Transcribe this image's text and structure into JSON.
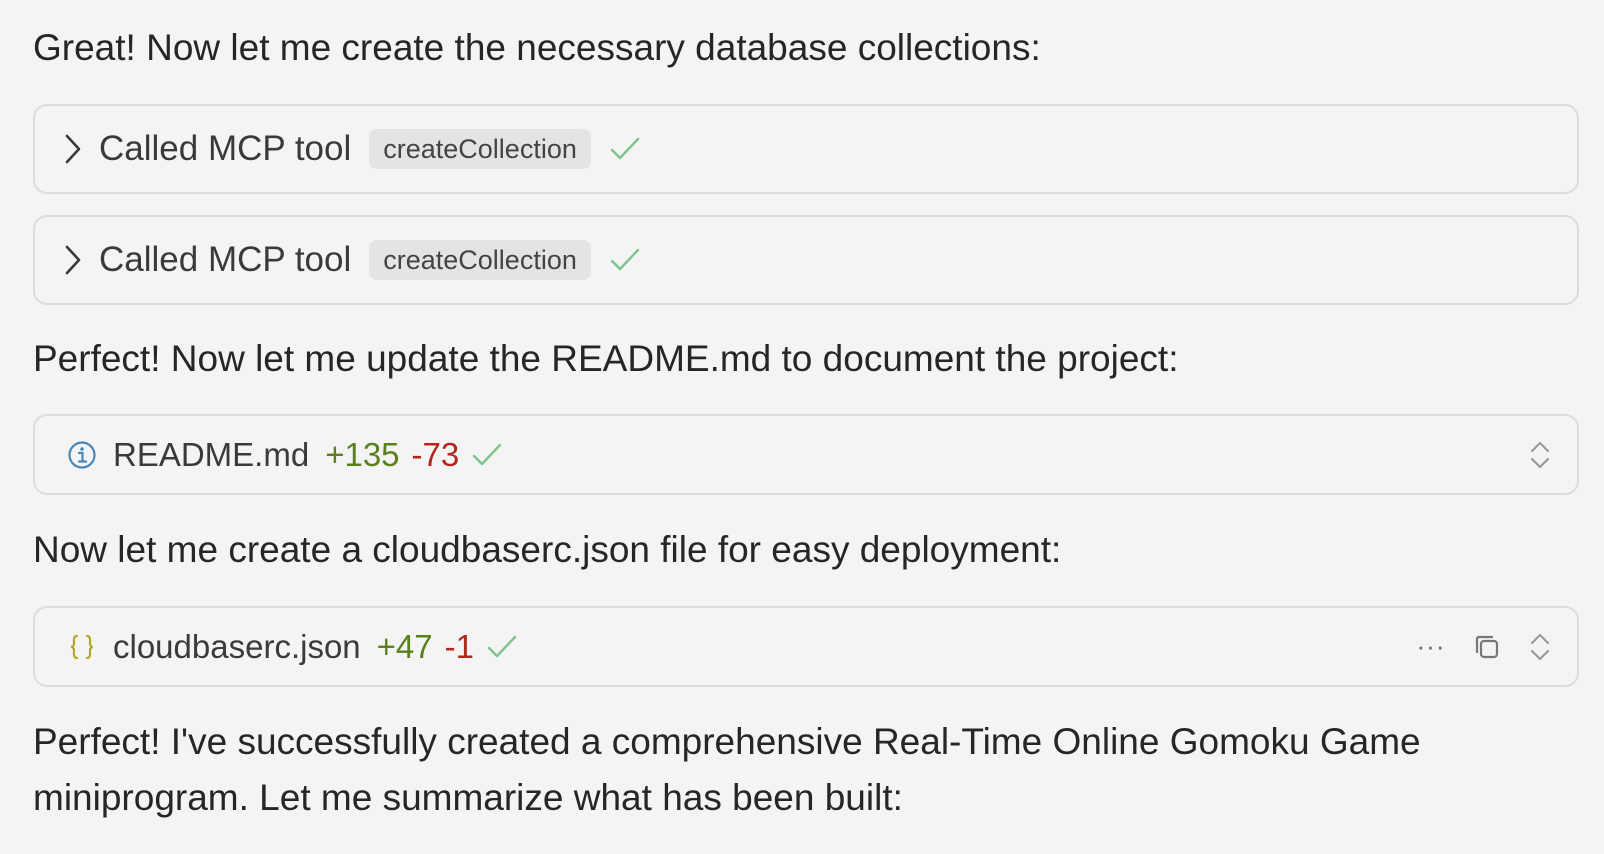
{
  "messages": [
    "Great! Now let me create the necessary database collections:",
    "Perfect! Now let me update the README.md to document the project:",
    "Now let me create a cloudbaserc.json file for easy deployment:",
    "Perfect! I've successfully created a comprehensive Real-Time Online Gomoku Game miniprogram. Let me summarize what has been built:"
  ],
  "tool_calls": [
    {
      "label": "Called MCP tool",
      "tool": "createCollection",
      "status": "success"
    },
    {
      "label": "Called MCP tool",
      "tool": "createCollection",
      "status": "success"
    }
  ],
  "file_edits": [
    {
      "icon": "info-icon",
      "name": "README.md",
      "added": "+135",
      "removed": "-73",
      "status": "success"
    },
    {
      "icon": "json-braces-icon",
      "name": "cloudbaserc.json",
      "added": "+47",
      "removed": "-1",
      "status": "success",
      "more_label": "···"
    }
  ],
  "colors": {
    "background": "#f4f4f4",
    "added": "#5a7f1e",
    "removed": "#b3261e",
    "check": "#7cc48a",
    "info_icon": "#4a86b8",
    "json_icon": "#b5a62a"
  }
}
